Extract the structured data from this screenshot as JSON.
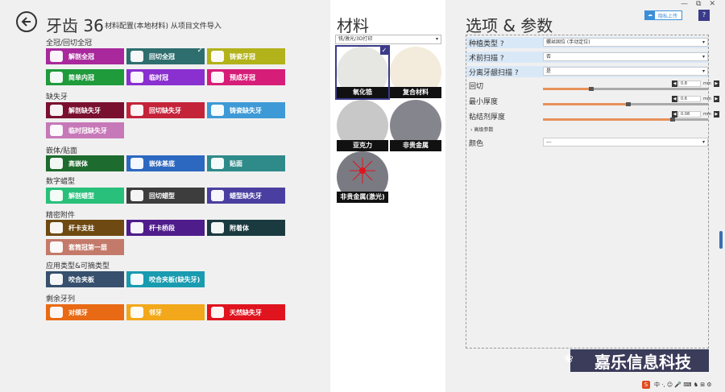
{
  "header": {
    "title": "牙齿 36",
    "subtitle": "材料配置(本地材料) 从项目文件导入"
  },
  "categories": [
    {
      "label": "全冠/回切全冠",
      "tiles": [
        {
          "label": "解剖全冠",
          "color": "#a9289c",
          "icon": "crown-icon"
        },
        {
          "label": "回切全冠",
          "color": "#2e6e6e",
          "icon": "cutback-crown-icon",
          "selected": true
        },
        {
          "label": "铸瓷牙冠",
          "color": "#b2b21a",
          "icon": "pressed-crown-icon"
        },
        {
          "label": "简单内冠",
          "color": "#1f9b3b",
          "icon": "coping-icon"
        },
        {
          "label": "临时冠",
          "color": "#8a2fd0",
          "icon": "temp-crown-icon"
        },
        {
          "label": "预成牙冠",
          "color": "#d61e78",
          "icon": "preformed-crown-icon"
        }
      ]
    },
    {
      "label": "缺失牙",
      "tiles": [
        {
          "label": "解剖缺失牙",
          "color": "#7a1030",
          "icon": "pontic-icon"
        },
        {
          "label": "回切缺失牙",
          "color": "#c4243a",
          "icon": "cutback-pontic-icon"
        },
        {
          "label": "铸瓷缺失牙",
          "color": "#3e9ad6",
          "icon": "pressed-pontic-icon"
        },
        {
          "label": "临时冠缺失牙",
          "color": "#c678b8",
          "icon": "temp-pontic-icon"
        }
      ]
    },
    {
      "label": "嵌体/贴面",
      "tiles": [
        {
          "label": "高嵌体",
          "color": "#1d6b2e",
          "icon": "onlay-icon"
        },
        {
          "label": "嵌体基底",
          "color": "#2c68c0",
          "icon": "inlay-icon"
        },
        {
          "label": "贴面",
          "color": "#2f8a8a",
          "icon": "veneer-icon"
        }
      ]
    },
    {
      "label": "数字蜡型",
      "tiles": [
        {
          "label": "解剖蜡型",
          "color": "#28c07a",
          "icon": "wax-up-icon"
        },
        {
          "label": "回切蜡型",
          "color": "#3d3d3d",
          "icon": "cutback-wax-icon"
        },
        {
          "label": "蜡型缺失牙",
          "color": "#4a3fa0",
          "icon": "wax-pontic-icon"
        }
      ]
    },
    {
      "label": "精密附件",
      "tiles": [
        {
          "label": "杆卡支柱",
          "color": "#6e4a12",
          "icon": "bar-post-icon"
        },
        {
          "label": "杆卡桥段",
          "color": "#4f1c8c",
          "icon": "bar-segment-icon"
        },
        {
          "label": "附着体",
          "color": "#1a3a40",
          "icon": "attachment-icon"
        },
        {
          "label": "套筒冠第一层",
          "color": "#c47a6a",
          "icon": "telescope-crown-icon"
        }
      ]
    },
    {
      "label": "应用类型&可摘类型",
      "tiles": [
        {
          "label": "咬合夹板",
          "color": "#36506e",
          "icon": "splint-icon"
        },
        {
          "label": "咬合夹板(缺失牙)",
          "color": "#199bb0",
          "icon": "splint-pontic-icon"
        }
      ]
    },
    {
      "label": "剩余牙列",
      "tiles": [
        {
          "label": "对颌牙",
          "color": "#e86a14",
          "icon": "antagonist-icon"
        },
        {
          "label": "邻牙",
          "color": "#f2a81a",
          "icon": "adjacent-tooth-icon"
        },
        {
          "label": "天然缺失牙",
          "color": "#e0141e",
          "icon": "missing-tooth-icon"
        }
      ]
    }
  ],
  "materials": {
    "title": "材料",
    "filter": "铣/激光/3D打印",
    "items": [
      {
        "label": "氧化锆",
        "color": "#e6e6e3",
        "selected": true
      },
      {
        "label": "复合材料",
        "color": "#f3ebdc"
      },
      {
        "label": "亚克力",
        "color": "#c8c8c8"
      },
      {
        "label": "非贵金属",
        "color": "#85858d"
      },
      {
        "label": "非贵金属(激光)",
        "color": "#7a7a82"
      }
    ]
  },
  "options": {
    "title": "选项 & 参数",
    "share_label": "隐私上传",
    "help_label": "?",
    "rows": [
      {
        "label": "种植类型 ?",
        "value": "螺丝固位 (手动定位)",
        "type": "dropdown"
      },
      {
        "label": "术前扫描 ?",
        "value": "否",
        "type": "dropdown"
      },
      {
        "label": "分离牙龈扫描 ?",
        "value": "是",
        "type": "dropdown"
      },
      {
        "label": "回切",
        "value": "0.8",
        "unit": "mm",
        "type": "slider",
        "level": 0.28
      },
      {
        "label": "最小厚度",
        "value": "0.6",
        "unit": "mm",
        "type": "slider",
        "level": 0.5
      },
      {
        "label": "粘结剂厚度",
        "value": "0.08",
        "unit": "mm",
        "type": "slider",
        "level": 0.77
      }
    ],
    "advanced_label": "高级参数",
    "color_label": "颜色",
    "color_value": "---"
  },
  "window_controls": {
    "minimize": "—",
    "restore": "⧉",
    "close": "✕"
  },
  "watermark": "嘉乐信息科技",
  "tray": {
    "ime": "S",
    "text": "中 ·, ☺ 🎤 ⌨ ♞ ⊞ ⚙"
  }
}
